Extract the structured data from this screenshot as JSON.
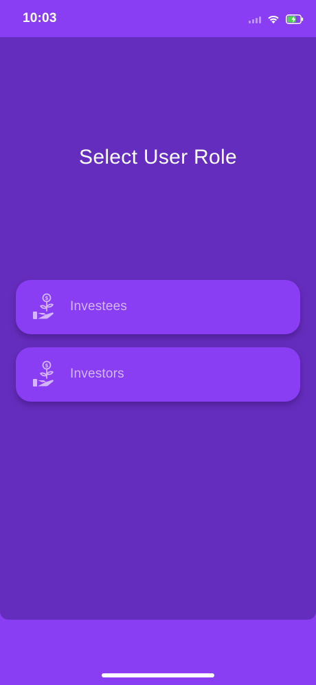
{
  "status_bar": {
    "time": "10:03",
    "icons": [
      "signal-icon",
      "wifi-icon",
      "battery-charging-icon"
    ]
  },
  "main": {
    "title": "Select User Role",
    "roles": [
      {
        "label": "Investees",
        "icon": "money-plant-hand-icon"
      },
      {
        "label": "Investors",
        "icon": "money-plant-hand-icon"
      }
    ]
  },
  "colors": {
    "background": "#8a3ef3",
    "panel": "#652dbd",
    "button": "#8a3ef3",
    "button_text": "#d4b6ff",
    "title_text": "#ffffff"
  }
}
